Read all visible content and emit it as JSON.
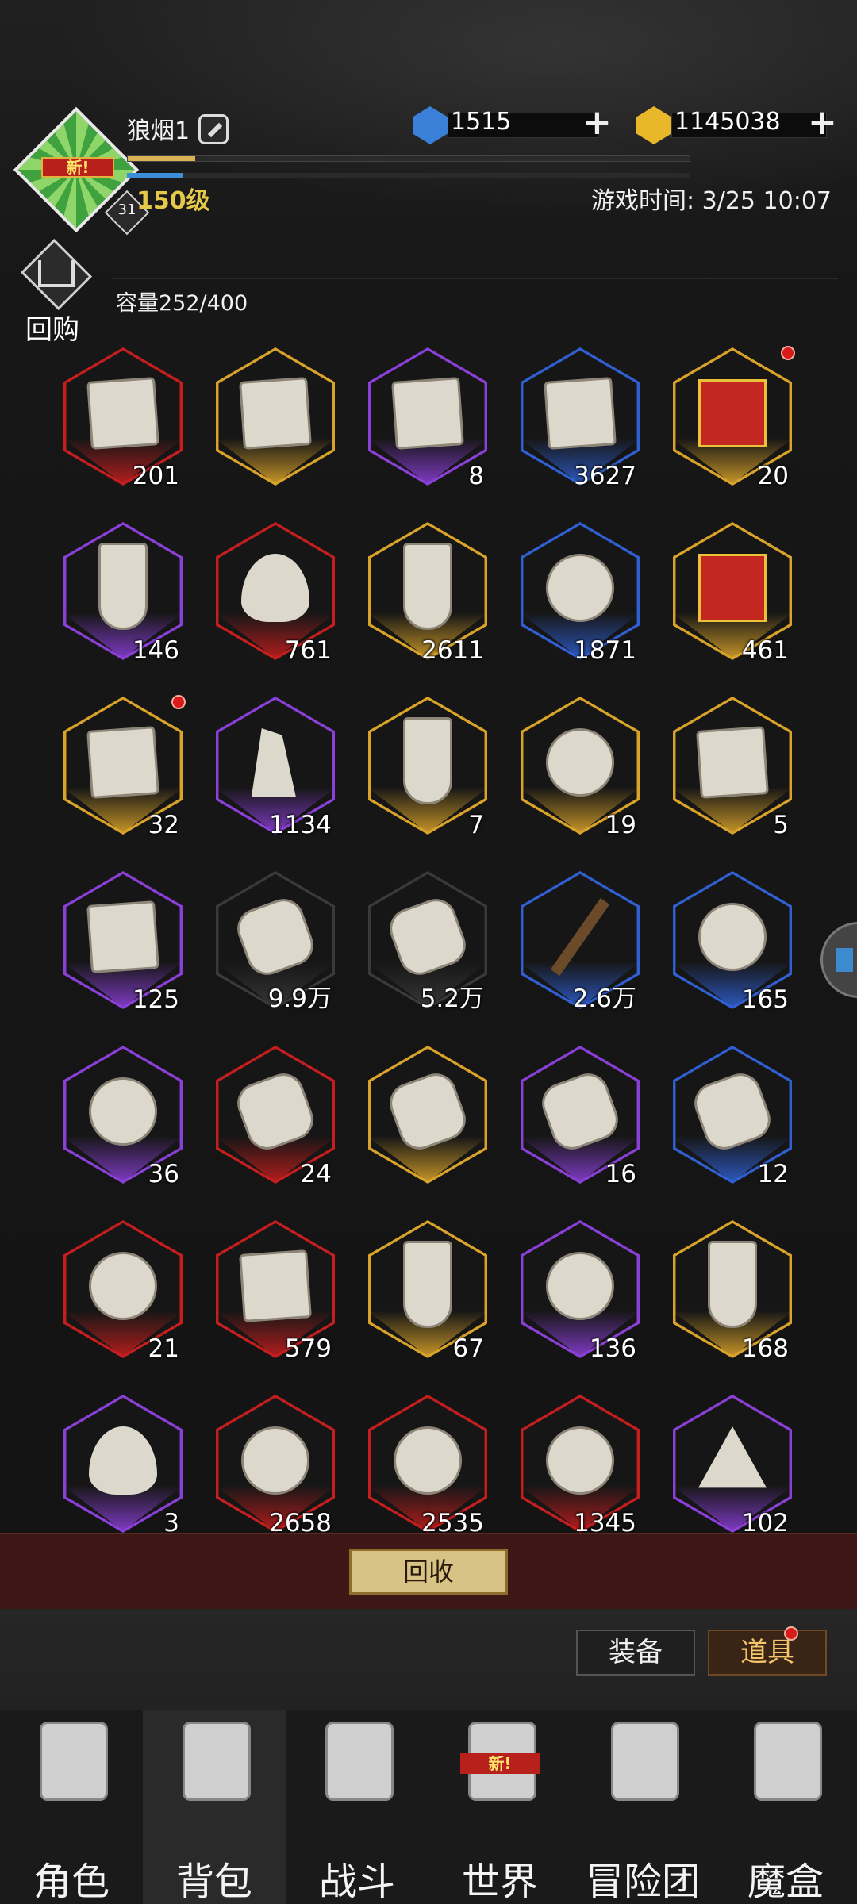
{
  "player": {
    "name": "狼烟1",
    "new_tag": "新!",
    "badge_level": "31",
    "level_label": "150级",
    "xp_fraction": 0.12,
    "mp_fraction": 0.1
  },
  "currencies": {
    "diamond": {
      "value": "1515",
      "color": "#3a7fd8"
    },
    "gold": {
      "value": "1145038",
      "color": "#e8b72a"
    }
  },
  "game_time": "游戏时间: 3/25 10:07",
  "buyback_label": "回购",
  "capacity": "容量252/400",
  "rarity_colors": {
    "red": "#c51e1e",
    "gold": "#d9a32a",
    "purple": "#8a3fd6",
    "blue": "#2f5fd0",
    "dark": "#3a3a3a"
  },
  "items": [
    {
      "icon": "map-icon",
      "shape": "scroll",
      "rarity": "red",
      "count": "201"
    },
    {
      "icon": "map-icon",
      "shape": "scroll",
      "rarity": "gold",
      "count": ""
    },
    {
      "icon": "map-icon",
      "shape": "scroll",
      "rarity": "purple",
      "count": "8"
    },
    {
      "icon": "map-icon",
      "shape": "scroll",
      "rarity": "blue",
      "count": "3627"
    },
    {
      "icon": "gift-box-icon",
      "shape": "gift",
      "rarity": "gold",
      "count": "20",
      "dot": true
    },
    {
      "icon": "hourglass-icon",
      "shape": "tall",
      "rarity": "purple",
      "count": "146"
    },
    {
      "icon": "flame-icon",
      "shape": "flame",
      "rarity": "red",
      "count": "761"
    },
    {
      "icon": "potion-bottle-icon",
      "shape": "tall",
      "rarity": "gold",
      "count": "2611"
    },
    {
      "icon": "laurel-crystal-icon",
      "shape": "round",
      "rarity": "blue",
      "count": "1871"
    },
    {
      "icon": "treasure-chest-icon",
      "shape": "gift",
      "rarity": "gold",
      "count": "461"
    },
    {
      "icon": "chest-icon",
      "shape": "scroll",
      "rarity": "gold",
      "count": "32",
      "dot": true
    },
    {
      "icon": "crystal-cluster-icon",
      "shape": "crystal",
      "rarity": "purple",
      "count": "1134"
    },
    {
      "icon": "rune-stone-icon",
      "shape": "tall",
      "rarity": "gold",
      "count": "7"
    },
    {
      "icon": "rune-pebble-icon",
      "shape": "round",
      "rarity": "gold",
      "count": "19"
    },
    {
      "icon": "hammer-icon",
      "shape": "scroll",
      "rarity": "gold",
      "count": "5"
    },
    {
      "icon": "sealed-scroll-icon",
      "shape": "scroll",
      "rarity": "purple",
      "count": "125"
    },
    {
      "icon": "torn-paper-icon",
      "shape": "slab",
      "rarity": "dark",
      "count": "9.9万"
    },
    {
      "icon": "scroll-fragment-icon",
      "shape": "slab",
      "rarity": "dark",
      "count": "5.2万"
    },
    {
      "icon": "torch-icon",
      "shape": "torch",
      "rarity": "blue",
      "count": "2.6万"
    },
    {
      "icon": "pocket-watch-icon",
      "shape": "round",
      "rarity": "blue",
      "count": "165"
    },
    {
      "icon": "chalice-icon",
      "shape": "round",
      "rarity": "purple",
      "count": "36"
    },
    {
      "icon": "rune-tablet-icon",
      "shape": "slab",
      "rarity": "red",
      "count": "24"
    },
    {
      "icon": "rune-tablet-icon",
      "shape": "slab",
      "rarity": "gold",
      "count": ""
    },
    {
      "icon": "rune-tablet-icon",
      "shape": "slab",
      "rarity": "purple",
      "count": "16"
    },
    {
      "icon": "rune-tablet-icon",
      "shape": "slab",
      "rarity": "blue",
      "count": "12"
    },
    {
      "icon": "crescent-moon-icon",
      "shape": "round",
      "rarity": "red",
      "count": "21"
    },
    {
      "icon": "stone-shard-icon",
      "shape": "scroll",
      "rarity": "red",
      "count": "579"
    },
    {
      "icon": "stone-pillar-icon",
      "shape": "tall",
      "rarity": "gold",
      "count": "67"
    },
    {
      "icon": "gem-drop-icon",
      "shape": "round",
      "rarity": "purple",
      "count": "136"
    },
    {
      "icon": "stone-plate-icon",
      "shape": "tall",
      "rarity": "gold",
      "count": "168"
    },
    {
      "icon": "spirit-flame-icon",
      "shape": "flame",
      "rarity": "purple",
      "count": "3"
    },
    {
      "icon": "meteorite-icon",
      "shape": "round",
      "rarity": "red",
      "count": "2658"
    },
    {
      "icon": "meteorite-icon",
      "shape": "round",
      "rarity": "red",
      "count": "2535"
    },
    {
      "icon": "meteorite-icon",
      "shape": "round",
      "rarity": "red",
      "count": "1345"
    },
    {
      "icon": "sand-pile-icon",
      "shape": "tri",
      "rarity": "purple",
      "count": "102"
    }
  ],
  "recycle_label": "回收",
  "filter_tabs": [
    {
      "label": "装备",
      "active": false
    },
    {
      "label": "道具",
      "active": true
    }
  ],
  "nav": [
    {
      "label": "角色",
      "icon": "helmet-icon"
    },
    {
      "label": "背包",
      "icon": "backpack-icon",
      "active": true
    },
    {
      "label": "战斗",
      "icon": "shield-sword-icon"
    },
    {
      "label": "世界",
      "icon": "world-scroll-icon",
      "badge": "新!"
    },
    {
      "label": "冒险团",
      "icon": "castle-icon"
    },
    {
      "label": "魔盒",
      "icon": "magic-box-icon"
    }
  ]
}
